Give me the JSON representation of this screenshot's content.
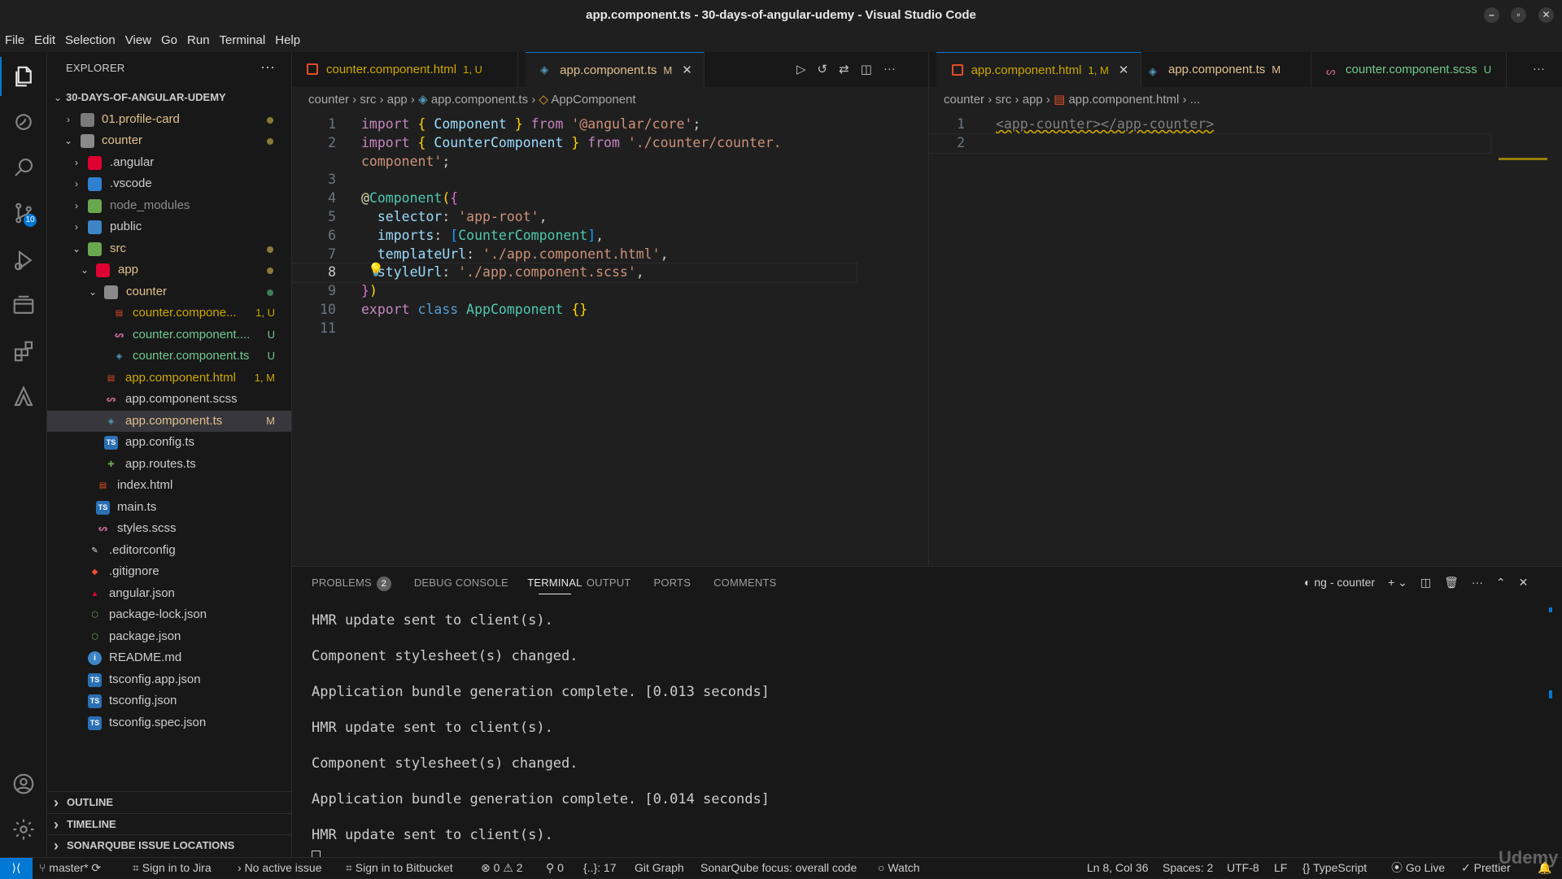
{
  "window": {
    "title": "app.component.ts - 30-days-of-angular-udemy - Visual Studio Code"
  },
  "menu": [
    "File",
    "Edit",
    "Selection",
    "View",
    "Go",
    "Run",
    "Terminal",
    "Help"
  ],
  "activity": {
    "scm_badge": "10"
  },
  "explorer": {
    "header": "EXPLORER",
    "root": "30-DAYS-OF-ANGULAR-UDEMY",
    "items": [
      {
        "label": "01.profile-card",
        "decoration": "",
        "color": "#e2c08d"
      },
      {
        "label": "counter",
        "decoration": "",
        "color": "#e2c08d"
      },
      {
        "label": ".angular",
        "decoration": "",
        "color": "#cccccc"
      },
      {
        "label": ".vscode",
        "decoration": "",
        "color": "#cccccc"
      },
      {
        "label": "node_modules",
        "decoration": "",
        "color": "#8c8c8c"
      },
      {
        "label": "public",
        "decoration": "",
        "color": "#cccccc"
      },
      {
        "label": "src",
        "decoration": "",
        "color": "#e2c08d"
      },
      {
        "label": "app",
        "decoration": "",
        "color": "#e2c08d"
      },
      {
        "label": "counter",
        "decoration": "",
        "color": "#73c991"
      },
      {
        "label": "counter.compone...",
        "decoration": "1, U",
        "color": "#cca700"
      },
      {
        "label": "counter.component....",
        "decoration": "U",
        "color": "#73c991"
      },
      {
        "label": "counter.component.ts",
        "decoration": "U",
        "color": "#73c991"
      },
      {
        "label": "app.component.html",
        "decoration": "1, M",
        "color": "#cca700"
      },
      {
        "label": "app.component.scss",
        "decoration": "",
        "color": "#cccccc"
      },
      {
        "label": "app.component.ts",
        "decoration": "M",
        "color": "#e2c08d"
      },
      {
        "label": "app.config.ts",
        "decoration": "",
        "color": "#cccccc"
      },
      {
        "label": "app.routes.ts",
        "decoration": "",
        "color": "#cccccc"
      },
      {
        "label": "index.html",
        "decoration": "",
        "color": "#cccccc"
      },
      {
        "label": "main.ts",
        "decoration": "",
        "color": "#cccccc"
      },
      {
        "label": "styles.scss",
        "decoration": "",
        "color": "#cccccc"
      },
      {
        "label": ".editorconfig",
        "decoration": "",
        "color": "#cccccc"
      },
      {
        "label": ".gitignore",
        "decoration": "",
        "color": "#cccccc"
      },
      {
        "label": "angular.json",
        "decoration": "",
        "color": "#cccccc"
      },
      {
        "label": "package-lock.json",
        "decoration": "",
        "color": "#cccccc"
      },
      {
        "label": "package.json",
        "decoration": "",
        "color": "#cccccc"
      },
      {
        "label": "README.md",
        "decoration": "",
        "color": "#cccccc"
      },
      {
        "label": "tsconfig.app.json",
        "decoration": "",
        "color": "#cccccc"
      },
      {
        "label": "tsconfig.json",
        "decoration": "",
        "color": "#cccccc"
      },
      {
        "label": "tsconfig.spec.json",
        "decoration": "",
        "color": "#cccccc"
      }
    ],
    "sections": [
      "OUTLINE",
      "TIMELINE",
      "SONARQUBE ISSUE LOCATIONS"
    ]
  },
  "editor_left": {
    "tabs": [
      {
        "label": "counter.component.html",
        "decoration": "1, U",
        "color": "#cca700"
      },
      {
        "label": "app.component.ts",
        "decoration": "M",
        "color": "#e2c08d"
      }
    ],
    "breadcrumb": [
      "counter",
      "src",
      "app",
      "app.component.ts",
      "AppComponent"
    ],
    "line_numbers": [
      "1",
      "2",
      "",
      "3",
      "4",
      "5",
      "6",
      "7",
      "8",
      "9",
      "10",
      "11"
    ]
  },
  "editor_right": {
    "tabs": [
      {
        "label": "app.component.html",
        "decoration": "1, M",
        "color": "#cca700"
      },
      {
        "label": "app.component.ts",
        "decoration": "M",
        "color": "#e2c08d"
      },
      {
        "label": "counter.component.scss",
        "decoration": "U",
        "color": "#73c991"
      }
    ],
    "breadcrumb": [
      "counter",
      "src",
      "app",
      "app.component.html",
      "..."
    ],
    "line_numbers": [
      "1",
      "2"
    ],
    "code_line1": "<app-counter></app-counter>"
  },
  "panel": {
    "tabs": [
      "PROBLEMS",
      "DEBUG CONSOLE",
      "TERMINAL",
      "OUTPUT",
      "PORTS",
      "COMMENTS"
    ],
    "problems_count": "2",
    "terminal_name": "ng - counter",
    "terminal_lines": [
      "HMR update sent to client(s).",
      "Component stylesheet(s) changed.",
      "Application bundle generation complete. [0.013 seconds]",
      "HMR update sent to client(s).",
      "Component stylesheet(s) changed.",
      "Application bundle generation complete. [0.014 seconds]",
      "HMR update sent to client(s)."
    ]
  },
  "status": {
    "branch": "master*",
    "jira": "Sign in to Jira",
    "issue": "No active issue",
    "bitbucket": "Sign in to Bitbucket",
    "errors": "0",
    "warnings": "2",
    "ports": "0",
    "braces": "{..}: 17",
    "gitgraph": "Git Graph",
    "sonar": "SonarQube focus: overall code",
    "watch": "Watch",
    "position": "Ln 8, Col 36",
    "spaces": "Spaces: 2",
    "encoding": "UTF-8",
    "eol": "LF",
    "language": "TypeScript",
    "golive": "Go Live",
    "prettier": "Prettier"
  },
  "watermark": "Udemy"
}
